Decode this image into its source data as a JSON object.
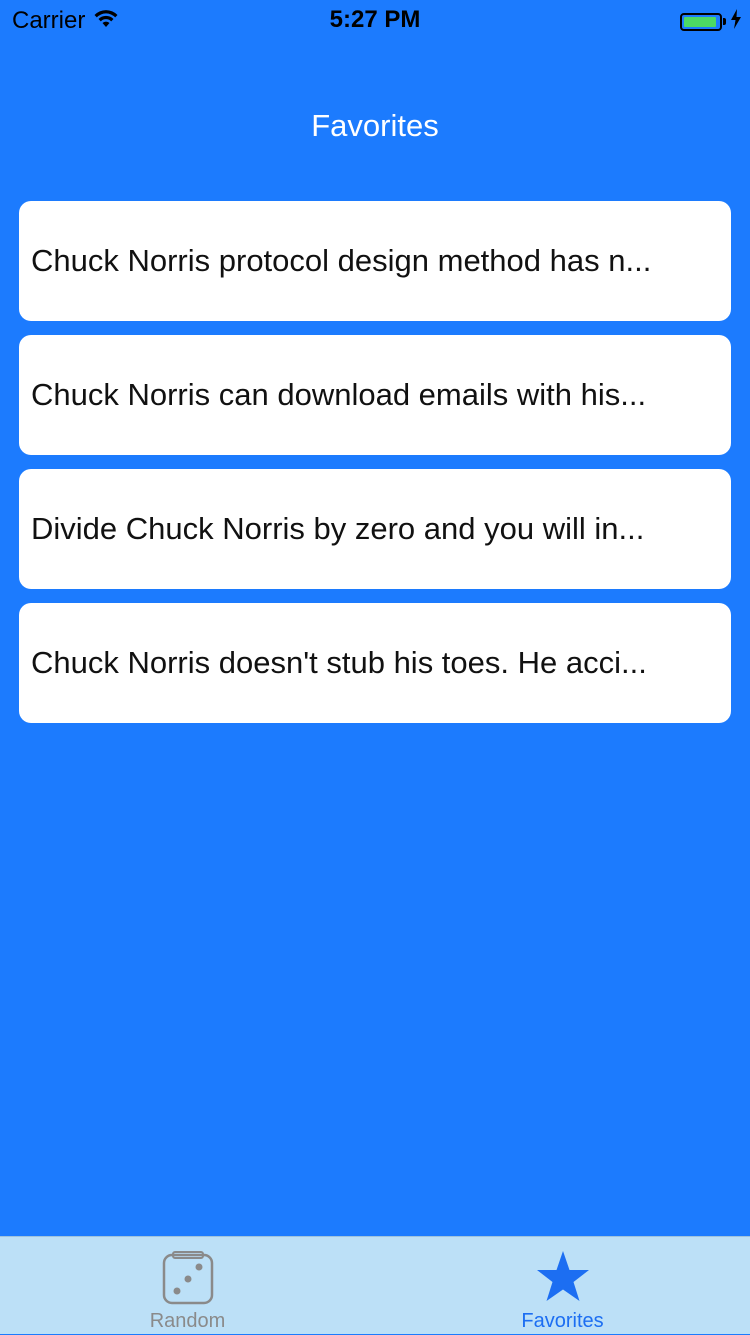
{
  "status_bar": {
    "carrier": "Carrier",
    "time": "5:27 PM",
    "battery_level": 0.95,
    "battery_color": "#4CD964",
    "icons": [
      "wifi-icon",
      "battery-icon",
      "charging-bolt-icon"
    ]
  },
  "nav": {
    "title": "Favorites"
  },
  "favorites": [
    {
      "text": "Chuck Norris protocol design method has n..."
    },
    {
      "text": "Chuck Norris can download emails with his..."
    },
    {
      "text": "Divide Chuck Norris by zero and you will in..."
    },
    {
      "text": "Chuck Norris doesn't stub his toes. He acci..."
    }
  ],
  "tab_bar": {
    "tabs": [
      {
        "label": "Random",
        "icon": "dice-icon",
        "selected": false
      },
      {
        "label": "Favorites",
        "icon": "star-icon",
        "selected": true
      }
    ]
  },
  "colors": {
    "background": "#1C7BFE",
    "card": "#FFFFFF",
    "tab_bar": "#BCE0F7",
    "tab_active": "#1C6EF2",
    "tab_inactive": "#8A8A8A"
  }
}
